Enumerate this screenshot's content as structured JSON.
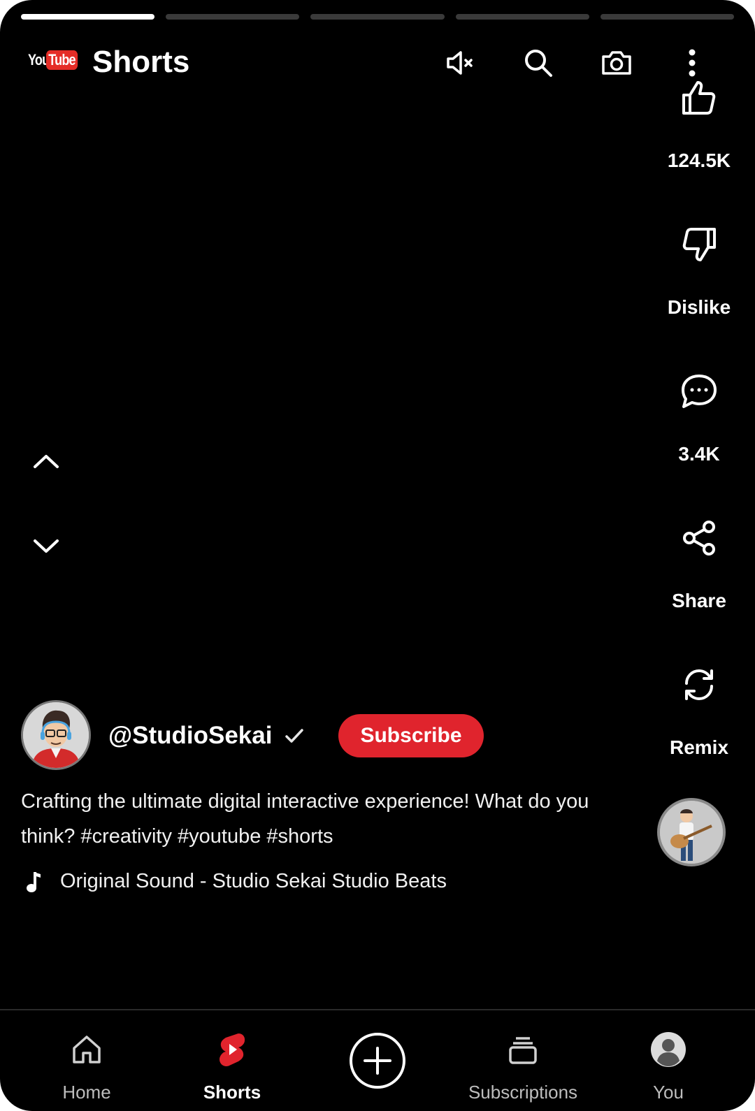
{
  "header": {
    "logo_you": "You",
    "logo_tube": "Tube",
    "title": "Shorts"
  },
  "progress": {
    "segments": 5,
    "active_index": 0
  },
  "rail": {
    "like_count": "124.5K",
    "dislike_label": "Dislike",
    "comment_count": "3.4K",
    "share_label": "Share",
    "remix_label": "Remix"
  },
  "video": {
    "channel": "@StudioSekai",
    "subscribe_label": "Subscribe",
    "description": "Crafting the ultimate digital interactive experience! What do you think? #creativity #youtube #shorts",
    "sound": "Original Sound - Studio Sekai Studio Beats"
  },
  "bottom_nav": {
    "home": "Home",
    "shorts": "Shorts",
    "subscriptions": "Subscriptions",
    "you": "You"
  },
  "colors": {
    "background": "#000000",
    "subscribe": "#e0242d",
    "brand_red": "#e52d27",
    "inactive_nav": "#bdbdbd"
  },
  "icons": [
    "mute-icon",
    "search-icon",
    "camera-icon",
    "more-vert-icon",
    "thumb-up-icon",
    "thumb-down-icon",
    "comment-icon",
    "share-icon",
    "remix-icon",
    "chevron-up-icon",
    "chevron-down-icon",
    "music-note-icon",
    "verified-check-icon",
    "home-icon",
    "shorts-icon",
    "create-plus-icon",
    "subscriptions-icon",
    "account-icon"
  ]
}
